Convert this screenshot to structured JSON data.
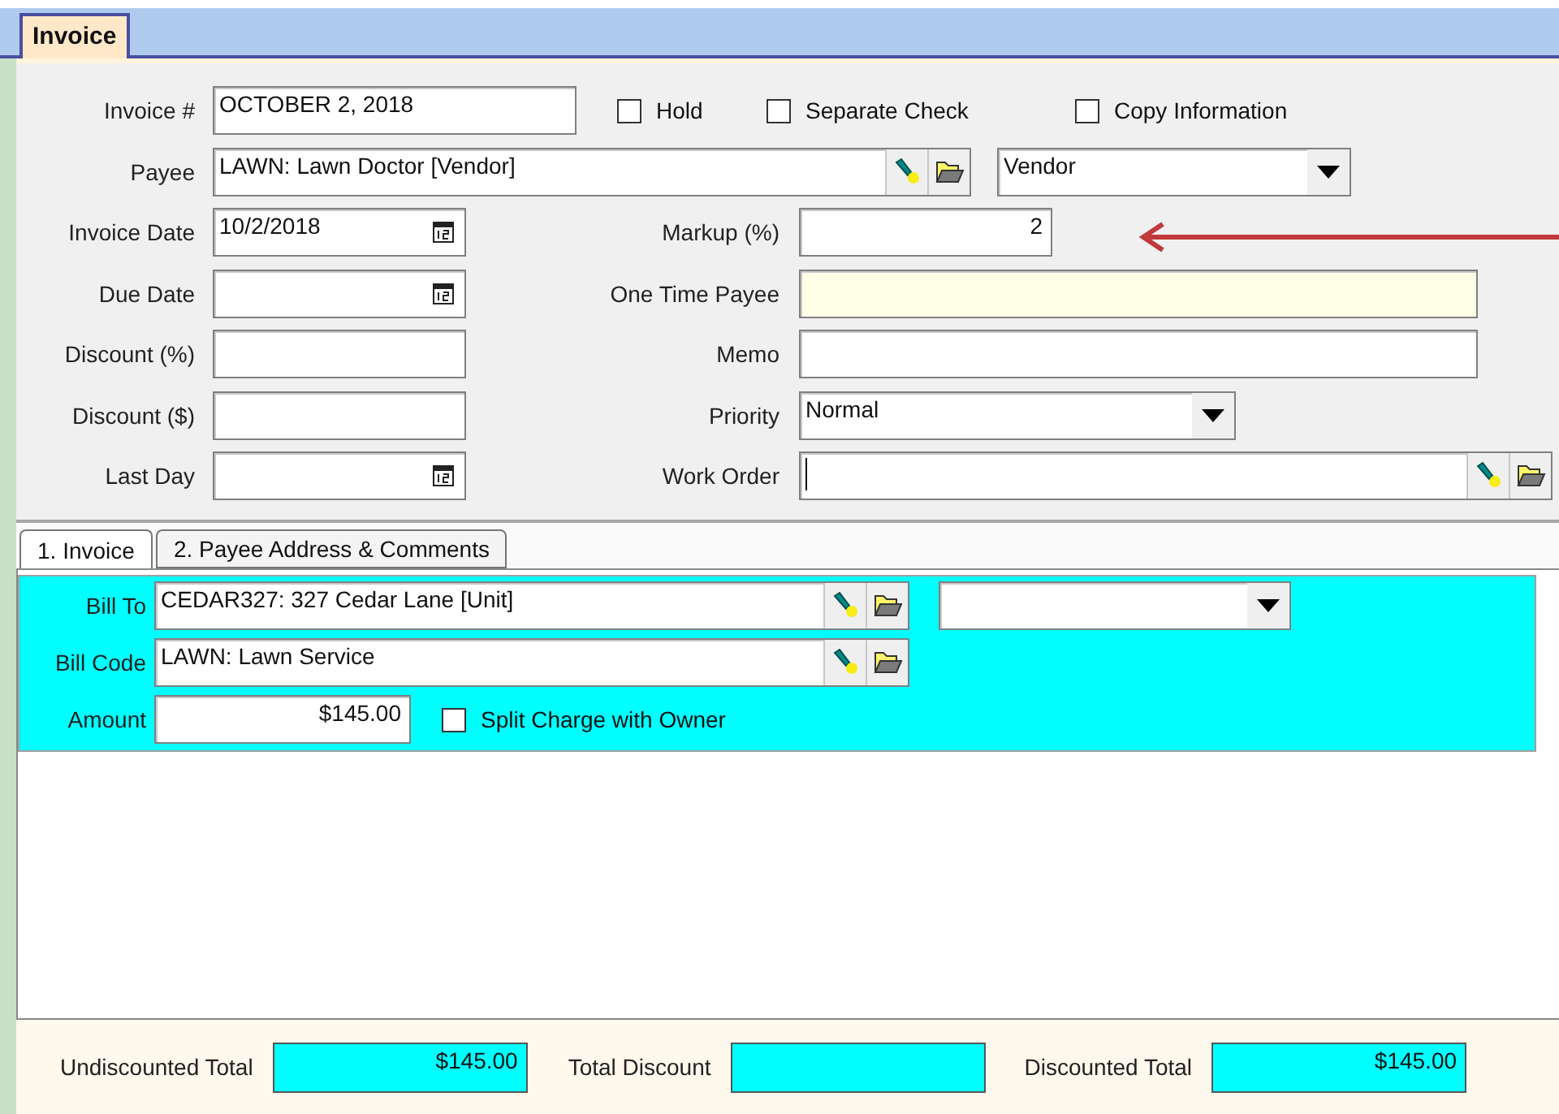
{
  "tab": {
    "label": "Invoice",
    "selected": true
  },
  "invoice_number": {
    "label": "Invoice #",
    "value": "OCTOBER 2, 2018"
  },
  "options": [
    {
      "label": "Hold",
      "checked": false
    },
    {
      "label": "Separate Check",
      "checked": false
    },
    {
      "label": "Copy Information",
      "checked": false
    }
  ],
  "payee": {
    "label": "Payee",
    "value": "LAWN: Lawn Doctor [Vendor]"
  },
  "payee_type": {
    "value": "Vendor"
  },
  "left_fields": [
    {
      "label": "Invoice Date",
      "value": "10/2/2018",
      "kind": "date"
    },
    {
      "label": "Due Date",
      "kind": "date"
    },
    {
      "label": "Discount (%)",
      "kind": "text"
    },
    {
      "label": "Discount ($)",
      "kind": "text"
    },
    {
      "label": "Last Day",
      "kind": "date"
    }
  ],
  "right_fields": [
    {
      "label": "Markup (%)",
      "value": "2",
      "kind": "number"
    },
    {
      "label": "One Time Payee",
      "kind": "highlight"
    },
    {
      "label": "Memo",
      "kind": "text"
    },
    {
      "label": "Priority",
      "value": "Normal",
      "kind": "dropdown"
    },
    {
      "label": "Work Order",
      "kind": "lookup"
    }
  ],
  "annotation": {
    "kind": "arrow"
  },
  "subtabs": [
    {
      "label": "1. Invoice",
      "selected": true
    },
    {
      "label": "2. Payee Address & Comments",
      "selected": false
    }
  ],
  "charge": {
    "bill_to": {
      "label": "Bill To",
      "value": "CEDAR327: 327 Cedar Lane [Unit]"
    },
    "bill_code": {
      "label": "Bill Code",
      "value": "LAWN: Lawn Service"
    },
    "amount": {
      "label": "Amount",
      "value": "$145.00"
    },
    "split": {
      "label": "Split Charge with Owner",
      "checked": false
    }
  },
  "totals": [
    {
      "label": "Undiscounted Total",
      "value": "$145.00"
    },
    {
      "label": "Total Discount"
    },
    {
      "label": "Discounted Total",
      "value": "$145.00"
    }
  ]
}
